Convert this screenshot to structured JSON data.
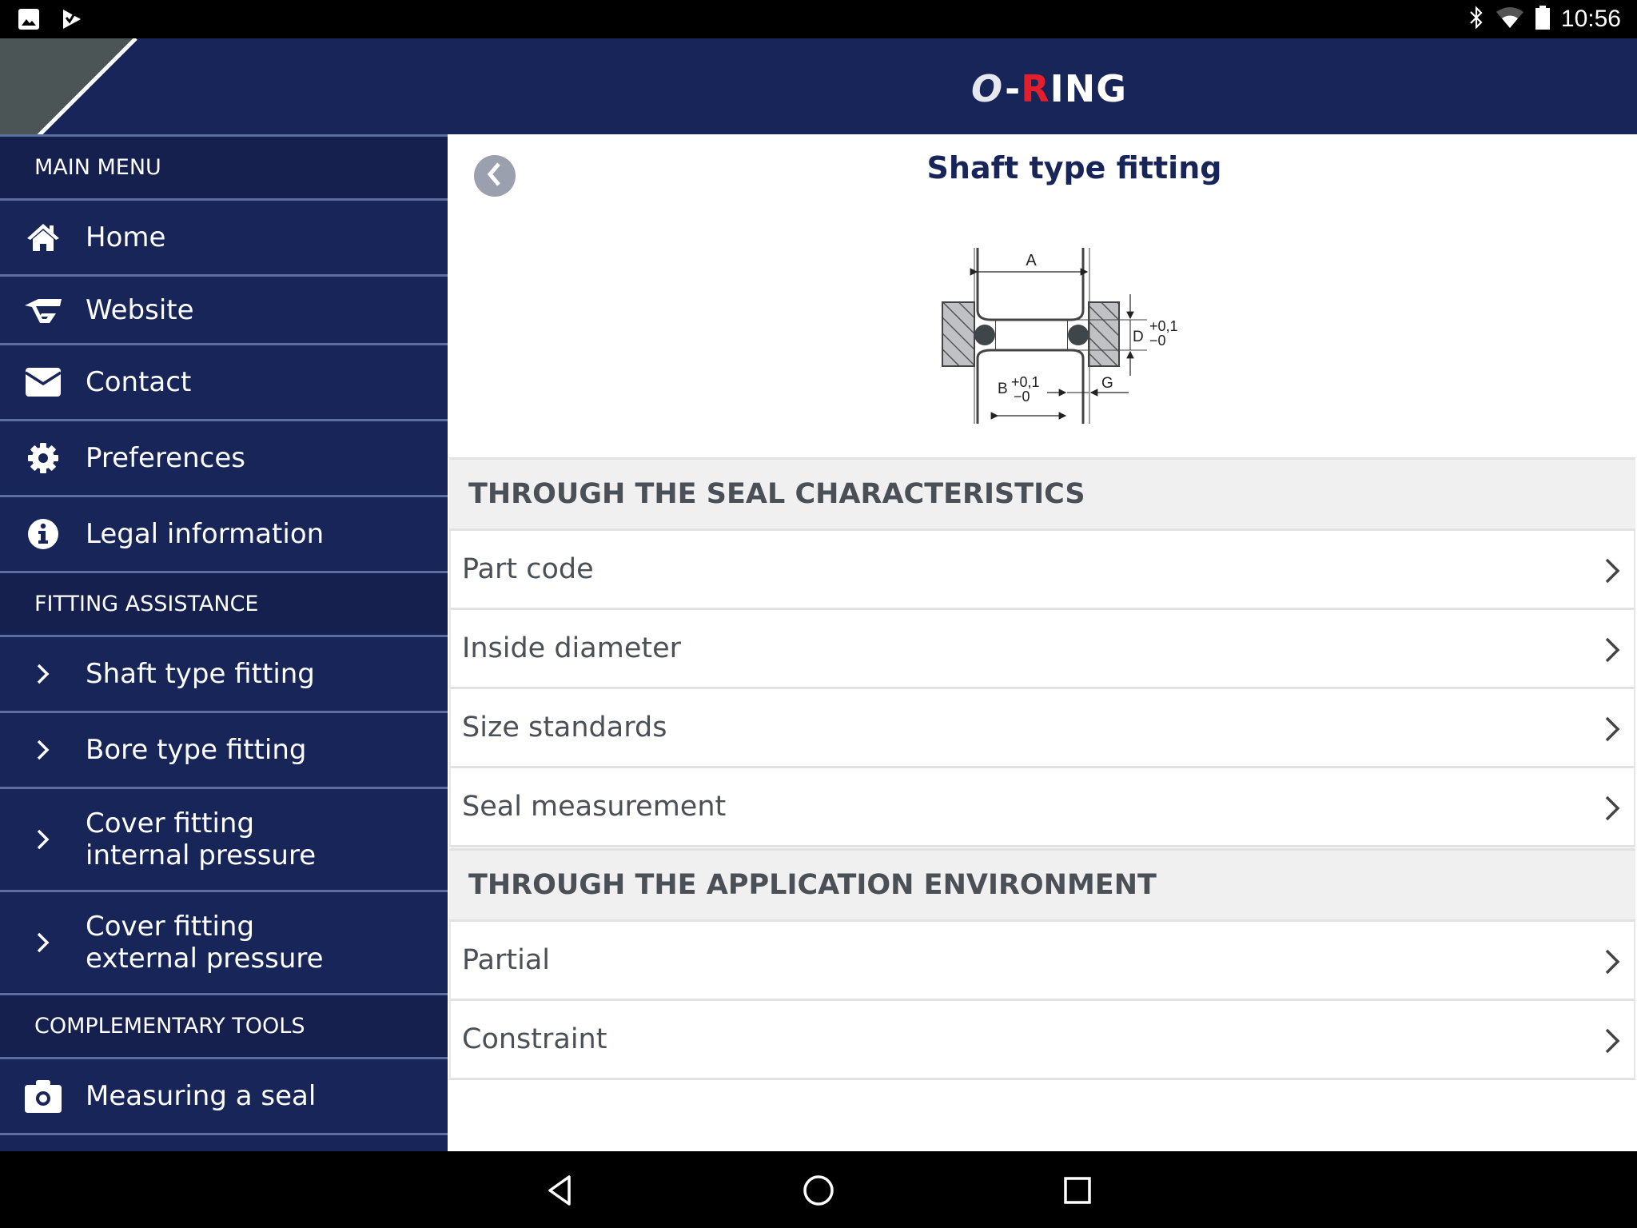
{
  "status_bar": {
    "time": "10:56",
    "left_icons": [
      "image-notification-icon",
      "play-store-notification-icon"
    ],
    "right_icons": [
      "bluetooth-icon",
      "wifi-icon",
      "battery-icon"
    ]
  },
  "header": {
    "logo": {
      "o": "O",
      "dash": "-",
      "r": "R",
      "rest": "ING"
    },
    "colors": {
      "background": "#172559",
      "logo_accent": "#e41e2b"
    }
  },
  "sidebar": {
    "sections": [
      {
        "title": "MAIN MENU",
        "items": [
          {
            "label": "Home",
            "icon": "home-icon"
          },
          {
            "label": "Website",
            "icon": "website-logo-icon"
          },
          {
            "label": "Contact",
            "icon": "envelope-icon"
          },
          {
            "label": "Preferences",
            "icon": "gear-icon"
          },
          {
            "label": "Legal information",
            "icon": "info-icon"
          }
        ]
      },
      {
        "title": "FITTING ASSISTANCE",
        "items": [
          {
            "label": "Shaft type fitting",
            "icon": "chevron-right-icon"
          },
          {
            "label": "Bore type fitting",
            "icon": "chevron-right-icon"
          },
          {
            "label": "Cover fitting\ninternal pressure",
            "icon": "chevron-right-icon"
          },
          {
            "label": "Cover fitting\nexternal pressure",
            "icon": "chevron-right-icon"
          }
        ]
      },
      {
        "title": "COMPLEMENTARY TOOLS",
        "items": [
          {
            "label": "Measuring a seal",
            "icon": "camera-icon"
          }
        ]
      }
    ]
  },
  "main": {
    "title": "Shaft type fitting",
    "back_icon": "back-chevron-icon",
    "diagram": {
      "labels": {
        "a": "A",
        "b": "B",
        "d": "D",
        "g": "G"
      },
      "tolerance_plus": "+0,1",
      "tolerance_minus": "−0"
    },
    "sections": [
      {
        "title": "THROUGH THE SEAL CHARACTERISTICS",
        "rows": [
          "Part code",
          "Inside diameter",
          "Size standards",
          "Seal measurement"
        ]
      },
      {
        "title": "THROUGH THE APPLICATION ENVIRONMENT",
        "rows": [
          "Partial",
          "Constraint"
        ]
      }
    ]
  },
  "nav_bar": {
    "buttons": [
      "back-triangle-icon",
      "home-circle-icon",
      "recents-square-icon"
    ]
  }
}
